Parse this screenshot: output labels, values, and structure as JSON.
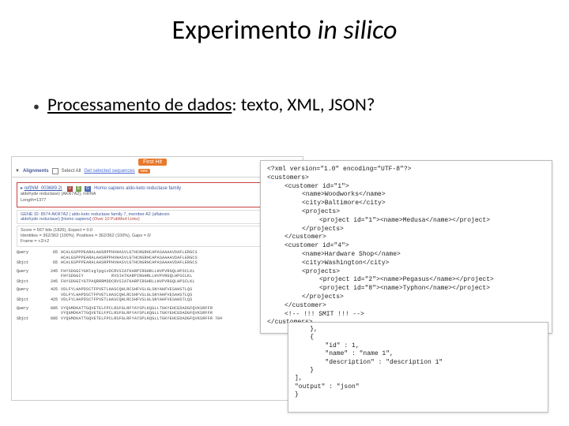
{
  "title_prefix": "Experimento ",
  "title_italic": "in silico",
  "bullet_underlined": "Processamento de dados",
  "bullet_rest": ": texto, XML, JSON?",
  "blast": {
    "first_hit": "First Hit",
    "alignments_label": "Alignments",
    "select_all": "Select All",
    "get_selected": "Get selected sequences",
    "new_badge": "new",
    "red_title": "ref|NM_003689.2|",
    "red_tags": {
      "u": "U",
      "e": "E",
      "g": "G"
    },
    "red_desc": "Homo sapiens aldo-keto reductase family",
    "red_sub1": "aldehyde reductase)  (AKR7A2), mRNA",
    "red_sub2": "Length=1377",
    "gene_text_prefix": "GENE ID: 8574 AKR7A2 | aldo-keto reductase family 7, member A2 (aflatoxin",
    "gene_text_sub": "aldehyde reductase) [Homo sapiens] ",
    "gene_pubmed": "(Over 10 PubMed Links)",
    "score_l1": "Score =  567 bits (1826),    Expect = 0.0",
    "score_l2": "Identities = 362/362 (100%), Positives = 362/362 (100%), Gaps = 0/",
    "score_l3": "Frame = +2/+2",
    "alignments": [
      {
        "q_num": "65",
        "q_seq": "HCALGSPPPEARALAHSRPPHVHASVLGTHCNGRHCAPASAAAAVDAFLERGCS",
        "m_seq": "HCALGSPPPEARALAHSRPPHVHASVLGTHCNGRHCAPASAAAAVDAFLERGCS",
        "s_num": "65",
        "s_seq": "HCALGSPPPEARALAHSRPPHVHASVLGTHCNGRHCAPASAAAAVDAFLERGCS"
      },
      {
        "q_num": "245",
        "q_seq": "FHYSDGGIYGNlsglpgivDCRVSIATKARPIRGHRLLHVPVRGQLHPSCLKL",
        "m_seq": "FHYSDGGIY           RVSIATKARPIRGHRLLHVPVRGQLHPSCLKL",
        "s_num": "245",
        "s_seq": "FHYSDGGIYGTPAQRRRMDDCRVSIATKARPIRGHRLLHVPVRGQLHPSCLKL"
      },
      {
        "q_num": "425",
        "q_seq": "VDLFYLHAPDSCTFPVETLHASCQHLRCSHFVSLGLSNYAHFVESAHSTLQS",
        "m_seq": "VDLFYLHAPDSCTFPVETLHASCQHLRCSHFVSLGLSNYAHFVESAHSTLQS",
        "s_num": "425",
        "s_seq": "VDLFYLHAPDSCTFPVETLHASCQHLRCSHFVSLGLSNYAHFVESAHSTLQS"
      },
      {
        "q_num": "605",
        "q_seq": "VYQGMDKATTGQVETELFPCLRSFGLRFYAYSPLKQGLLTGKYEHCEDADGFQVKSRFFR",
        "m_seq": "VYQGMDKATTGQVETELFPCLRSFGLRFYAYSPLKQGLLTGKYEHCEDADGFQVKSRFFR",
        "s_num": "605",
        "s_seq": "VYQGMDKATTGQVETELFPCLRSFGLRFYAYSPLKQGLLTGKYEHCEDADGFQVKSRFFR",
        "s_end": "784"
      }
    ]
  },
  "xml": {
    "l1": "<?xml version=\"1.0\" encoding=\"UTF-8\"?>",
    "l2": "<customers>",
    "l3": "<customer id=\"1\">",
    "l4": "<name>Woodworks</name>",
    "l5": "<city>Baltimore</city>",
    "l6": "<projects>",
    "l7": "<project id=\"1\"><name>Medusa</name></project>",
    "l8": "</projects>",
    "l9": "</customer>",
    "l10": "<customer id=\"4\">",
    "l11": "<name>Hardware Shop</name>",
    "l12": "<city>Washington</city>",
    "l13": "<projects>",
    "l14": "<project id=\"2\"><name>Pegasus</name></project>",
    "l15": "<project id=\"8\"><name>Typhon</name></project>",
    "l16": "</projects>",
    "l17": "</customer>",
    "l18": "<!-- !!! SMIT !!! -->",
    "l19": "</customers>"
  },
  "json": {
    "l1": "    },",
    "l2": "    {",
    "l3": "        \"id\" : 1,",
    "l4": "        \"name\" : \"name 1\",",
    "l5": "        \"description\" : \"description 1\"",
    "l6": "    }",
    "l7": "],",
    "l8": "\"output\" : \"json\"",
    "l9": "}"
  }
}
